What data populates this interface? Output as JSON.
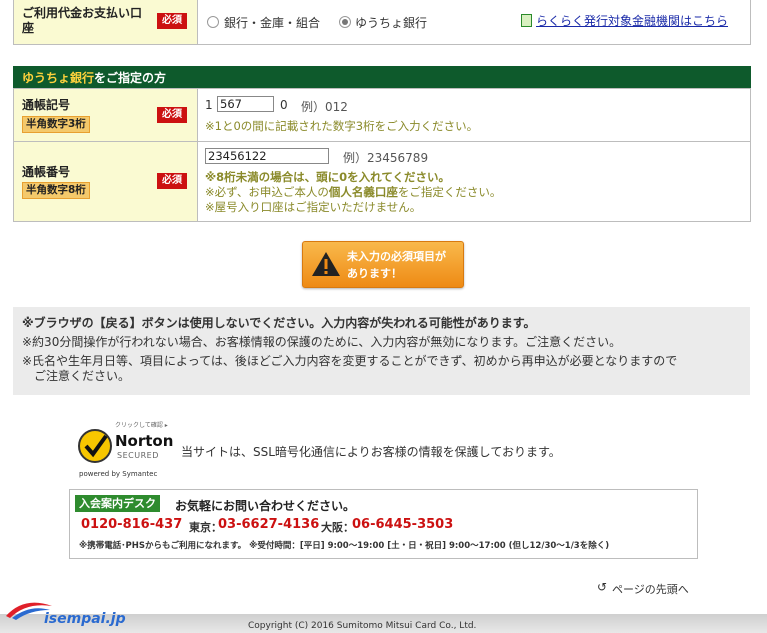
{
  "payment": {
    "label": "ご利用代金お支払い口座",
    "required": "必須",
    "options": [
      {
        "label": "銀行・金庫・組合",
        "selected": false
      },
      {
        "label": "ゆうちょ銀行",
        "selected": true
      }
    ],
    "link": "らくらく発行対象金融機関はこちら"
  },
  "yucho": {
    "header_bank": "ゆうちょ銀行",
    "header_rest": "をご指定の方",
    "kigou": {
      "label": "通帳記号",
      "required": "必須",
      "format": "半角数字3桁",
      "prefix": "1",
      "value": "567",
      "suffix": "0",
      "example": "例）012",
      "note": "※1と0の間に記載された数字3桁をご入力ください。"
    },
    "bangou": {
      "label": "通帳番号",
      "required": "必須",
      "format": "半角数字8桁",
      "value": "23456122",
      "example": "例）23456789",
      "note1": "※8桁未満の場合は、頭に0を入れてください。",
      "note2_a": "※必ず、お申込ご本人の",
      "note2_b": "個人名義口座",
      "note2_c": "をご指定ください。",
      "note3": "※屋号入り口座はご指定いただけません。"
    }
  },
  "warning_button": {
    "line1": "未入力の必須項目が",
    "line2": "あります！"
  },
  "notices": {
    "line1": "※ブラウザの【戻る】ボタンは使用しないでください。入力内容が失われる可能性があります。",
    "line2": "※約30分間操作が行われない場合、お客様情報の保護のために、入力内容が無効になります。ご注意ください。",
    "line3": "※氏名や生年月日等、項目によっては、後ほどご入力内容を変更することができず、初めから再申込が必要となりますので",
    "line4": "ご注意ください。"
  },
  "norton": {
    "small": "クリックして確認 ▸",
    "name": "Norton",
    "secured": "SECURED",
    "powered": "powered by Symantec",
    "ssl_text": "当サイトは、SSL暗号化通信によりお客様の情報を保護しております。"
  },
  "contact": {
    "desk": "入会案内デスク",
    "lead": "お気軽にお問い合わせください。",
    "tel_free": "0120-816-437",
    "tokyo_label": "東京：",
    "tokyo_tel": "03-6627-4136",
    "osaka_label": "大阪：",
    "osaka_tel": "06-6445-3503",
    "footnote": "※携帯電話･PHSからもご利用になれます。 ※受付時間：[平日] 9:00～19:00 [土・日・祝日] 9:00～17:00 (但し12/30～1/3を除く)"
  },
  "page_top": "ページの先頭へ",
  "watermark": "isempai.jp",
  "copyright": "Copyright (C) 2016 Sumitomo Mitsui Card Co., Ltd.",
  "colors": {
    "section_header": "#0e5a2c",
    "label_bg": "#fafad2",
    "required_bg": "#cc1111",
    "warn_bg": "#ee8a14",
    "link": "#1a2aa8"
  }
}
